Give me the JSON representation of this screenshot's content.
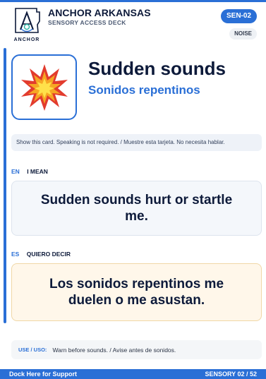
{
  "header": {
    "logo_text": "ANCHOR",
    "org_name": "ANCHOR ARKANSAS",
    "deck_name": "SENSORY ACCESS DECK",
    "card_code": "SEN-02",
    "category": "NOISE"
  },
  "card": {
    "icon": "explosion-burst-icon",
    "title_en": "Sudden sounds",
    "title_es": "Sonidos repentinos",
    "instruction": "Show this card. Speaking is not required. / Muestre esta tarjeta. No necesita hablar.",
    "en": {
      "code": "EN",
      "heading": "I MEAN",
      "text": "Sudden sounds hurt or startle me."
    },
    "es": {
      "code": "ES",
      "heading": "QUIERO DECIR",
      "text": "Los sonidos repentinos me duelen o me asustan."
    },
    "use_label": "USE / USO:",
    "use_text": "Warn before sounds. / Avise antes de sonidos."
  },
  "footer": {
    "left": "Dock Here for Support",
    "right": "SENSORY 02 / 52"
  },
  "colors": {
    "accent": "#2a6fd6",
    "ink": "#0d1a3a",
    "es_card_bg": "#fff7ea"
  }
}
